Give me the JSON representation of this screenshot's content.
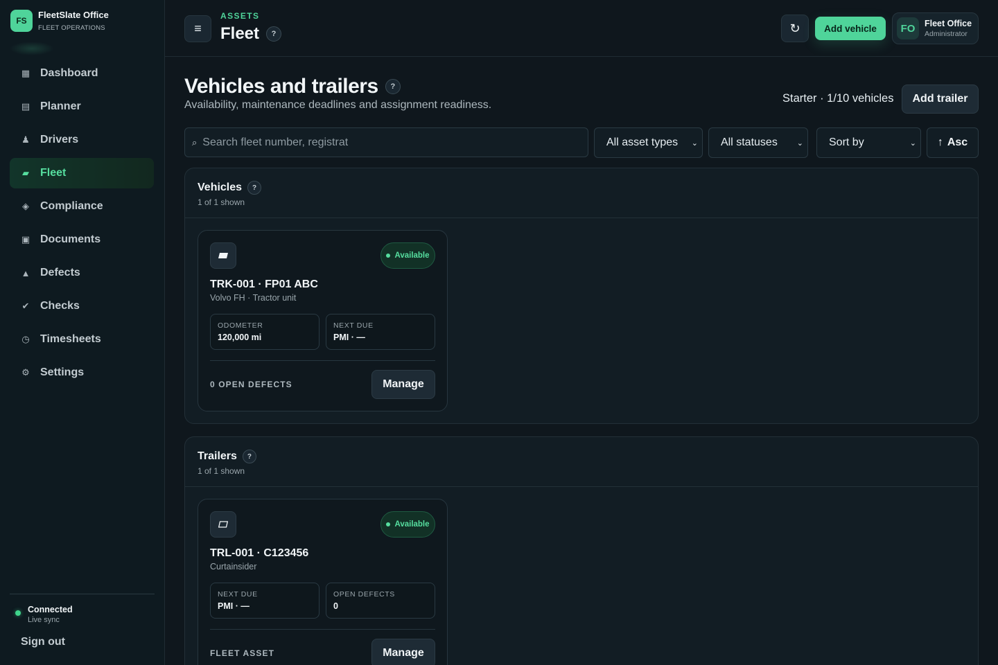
{
  "brand": {
    "logo": "FS",
    "name": "FleetSlate Office",
    "subtitle": "FLEET OPERATIONS"
  },
  "sidebar": {
    "items": [
      {
        "label": "Dashboard",
        "icon": "dashboard-icon",
        "glyph": "▦",
        "active": false
      },
      {
        "label": "Planner",
        "icon": "planner-icon",
        "glyph": "▤",
        "active": false
      },
      {
        "label": "Drivers",
        "icon": "driver-icon",
        "glyph": "♟",
        "active": false
      },
      {
        "label": "Fleet",
        "icon": "fleet-icon",
        "glyph": "▰",
        "active": true
      },
      {
        "label": "Compliance",
        "icon": "compliance-icon",
        "glyph": "◈",
        "active": false
      },
      {
        "label": "Documents",
        "icon": "documents-icon",
        "glyph": "▣",
        "active": false
      },
      {
        "label": "Defects",
        "icon": "warning-icon",
        "glyph": "▲",
        "active": false
      },
      {
        "label": "Checks",
        "icon": "check-icon",
        "glyph": "✔",
        "active": false
      },
      {
        "label": "Timesheets",
        "icon": "clock-icon",
        "glyph": "◷",
        "active": false
      },
      {
        "label": "Settings",
        "icon": "gear-icon",
        "glyph": "⚙",
        "active": false
      }
    ],
    "connection": {
      "title": "Connected",
      "subtitle": "Live sync"
    },
    "sign_out": "Sign out"
  },
  "header": {
    "breadcrumb": "ASSETS",
    "title": "Fleet",
    "help": "?",
    "refresh_glyph": "↻",
    "menu_glyph": "≡",
    "add_vehicle": "Add vehicle",
    "user": {
      "initials": "FO",
      "name": "Fleet Office",
      "role": "Administrator"
    }
  },
  "main": {
    "heading": "Vehicles and trailers",
    "help": "?",
    "subheading": "Availability, maintenance deadlines and assignment readiness.",
    "plan": "Starter · 1/10 vehicles",
    "add_trailer": "Add trailer",
    "filters": {
      "search_glyph": "⌕",
      "search_placeholder": "Search fleet number, registrat",
      "asset_type": "All asset types",
      "status": "All statuses",
      "sort": "Sort by",
      "order": "Asc",
      "order_glyph": "↑",
      "chevron": "⌄"
    },
    "vehicles_panel": {
      "title": "Vehicles",
      "count": "1 of 1 shown",
      "card": {
        "title": "TRK-001 · FP01 ABC",
        "subtitle": "Volvo FH · Tractor unit",
        "status": "Available",
        "stat1_label": "ODOMETER",
        "stat1_value": "120,000 mi",
        "stat2_label": "NEXT DUE",
        "stat2_value": "PMI · —",
        "footer": "0 OPEN DEFECTS",
        "manage": "Manage"
      }
    },
    "trailers_panel": {
      "title": "Trailers",
      "count": "1 of 1 shown",
      "card": {
        "title": "TRL-001 · C123456",
        "subtitle": "Curtainsider",
        "status": "Available",
        "stat1_label": "NEXT DUE",
        "stat1_value": "PMI · —",
        "stat2_label": "OPEN DEFECTS",
        "stat2_value": "0",
        "footer": "FLEET ASSET",
        "manage": "Manage"
      }
    }
  },
  "colors": {
    "accent": "#4fd49a",
    "background": "#0f171d",
    "panel": "#121d24"
  }
}
